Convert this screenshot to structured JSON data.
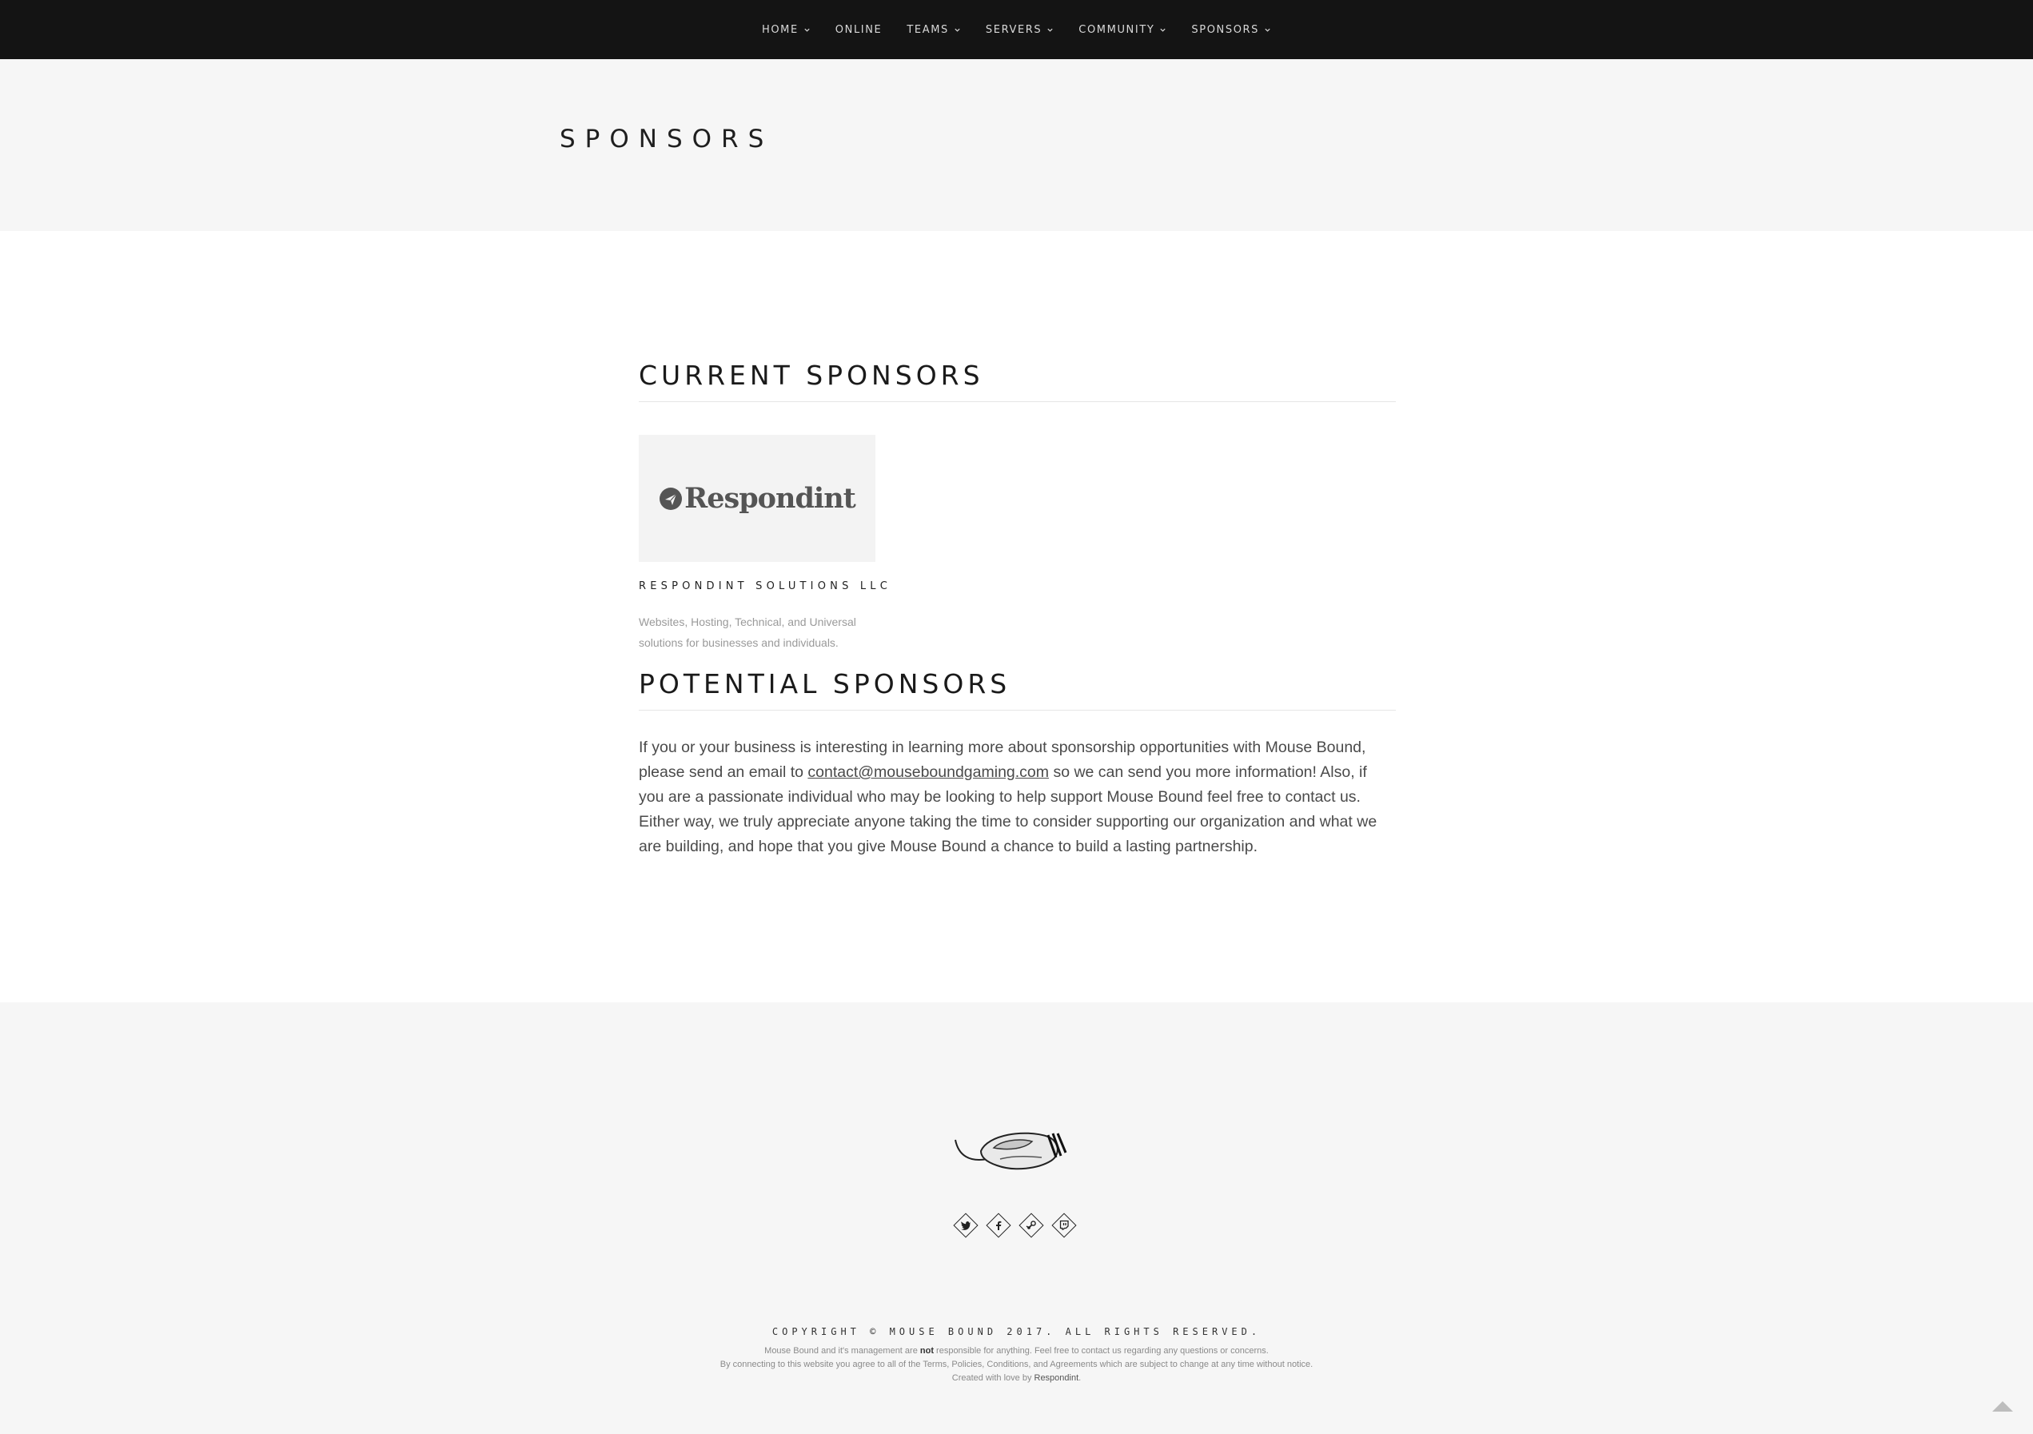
{
  "nav": {
    "items": [
      {
        "label": "HOME",
        "dropdown": true
      },
      {
        "label": "ONLINE",
        "dropdown": false
      },
      {
        "label": "TEAMS",
        "dropdown": true
      },
      {
        "label": "SERVERS",
        "dropdown": true
      },
      {
        "label": "COMMUNITY",
        "dropdown": true
      },
      {
        "label": "SPONSORS",
        "dropdown": true
      }
    ]
  },
  "header": {
    "title": "SPONSORS"
  },
  "current": {
    "title": "CURRENT SPONSORS",
    "sponsor": {
      "logo_text": "Respondint",
      "name": "RESPONDINT SOLUTIONS LLC",
      "description": "Websites, Hosting, Technical, and Universal solutions for businesses and individuals."
    }
  },
  "potential": {
    "title": "POTENTIAL SPONSORS",
    "text_before": "If you or your business is interesting in learning more about sponsorship opportunities with Mouse Bound, please send an email to ",
    "email": "contact@mouseboundgaming.com",
    "text_after": " so we can send you more information! Also, if you are a passionate individual who may be looking to help support Mouse Bound feel free to contact us. Either way, we truly appreciate anyone taking the time to consider supporting our organization and what we are building, and hope that you give Mouse Bound a chance to build a lasting partnership."
  },
  "footer": {
    "socials": [
      "twitter-icon",
      "facebook-icon",
      "steam-icon",
      "twitch-icon"
    ],
    "copyright": "COPYRIGHT © MOUSE BOUND 2017. ALL RIGHTS RESERVED.",
    "line1_before": "Mouse Bound and it's management are ",
    "line1_bold": "not",
    "line1_after": " responsible for anything. Feel free to contact us regarding any questions or concerns.",
    "line2": "By connecting to this website you agree to all of the Terms, Policies, Conditions, and Agreements which are subject to change at any time without notice.",
    "line3_before": "Created with love by ",
    "line3_brand": "Respondint",
    "line3_after": "."
  }
}
